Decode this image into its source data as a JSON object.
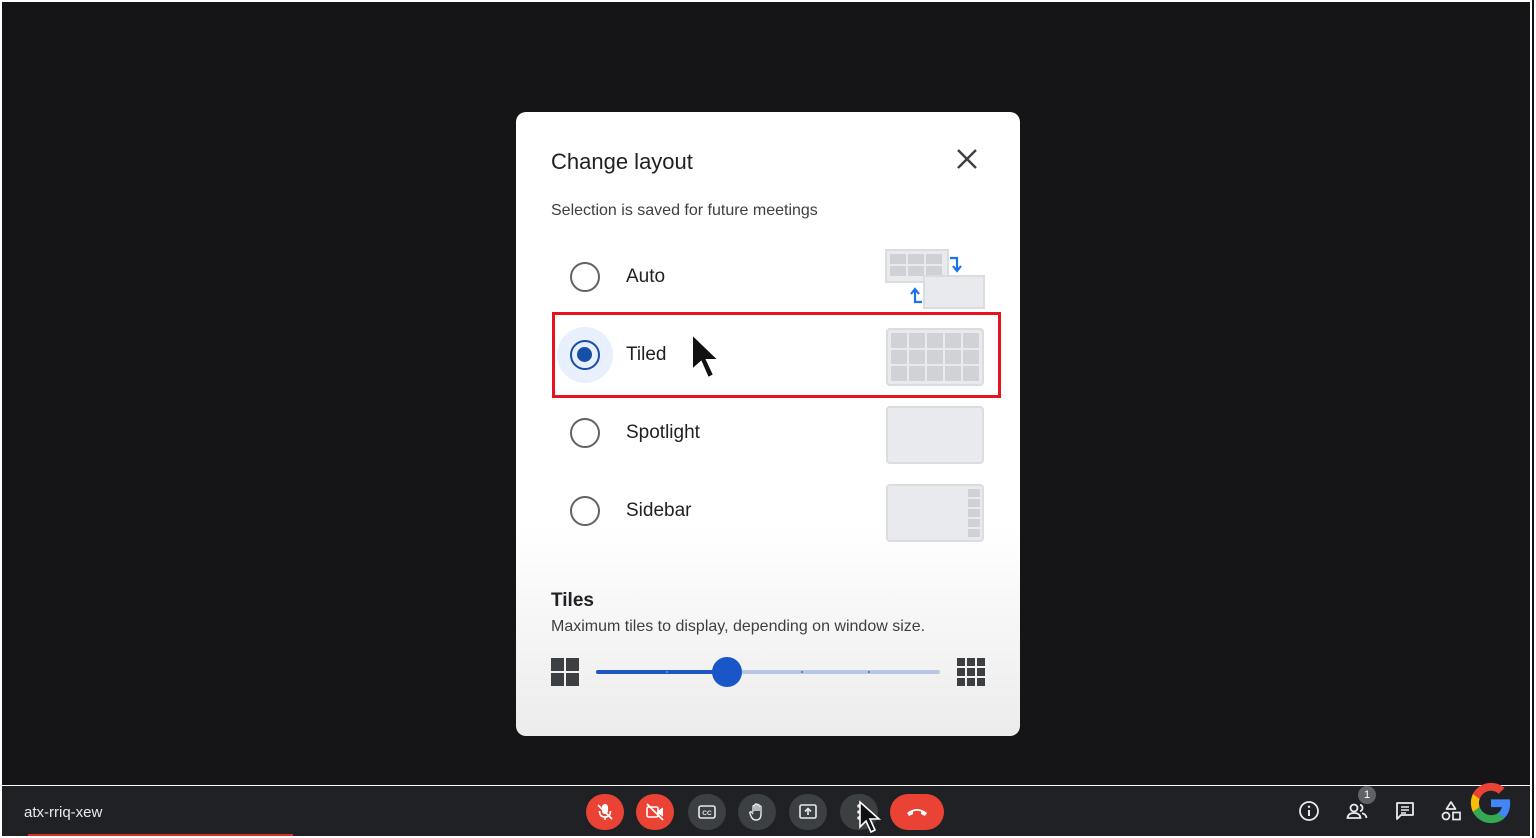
{
  "meeting": {
    "code": "atx-rriq-xew",
    "participant_count": "1"
  },
  "dialog": {
    "title": "Change layout",
    "subtitle": "Selection is saved for future meetings",
    "options": [
      {
        "label": "Auto",
        "selected": false
      },
      {
        "label": "Tiled",
        "selected": true
      },
      {
        "label": "Spotlight",
        "selected": false
      },
      {
        "label": "Sidebar",
        "selected": false
      }
    ],
    "tiles_title": "Tiles",
    "tiles_description": "Maximum tiles to display, depending on window size.",
    "tiles_slider_fraction": 0.38
  },
  "colors": {
    "accent": "#1a56c8",
    "end_call": "#ea4335",
    "highlight": "#e8111e"
  },
  "icons": [
    "close-icon",
    "mic-off-icon",
    "camera-off-icon",
    "captions-icon",
    "raise-hand-icon",
    "present-icon",
    "more-options-icon",
    "end-call-icon",
    "info-icon",
    "people-icon",
    "chat-icon",
    "activities-icon",
    "google-logo"
  ]
}
